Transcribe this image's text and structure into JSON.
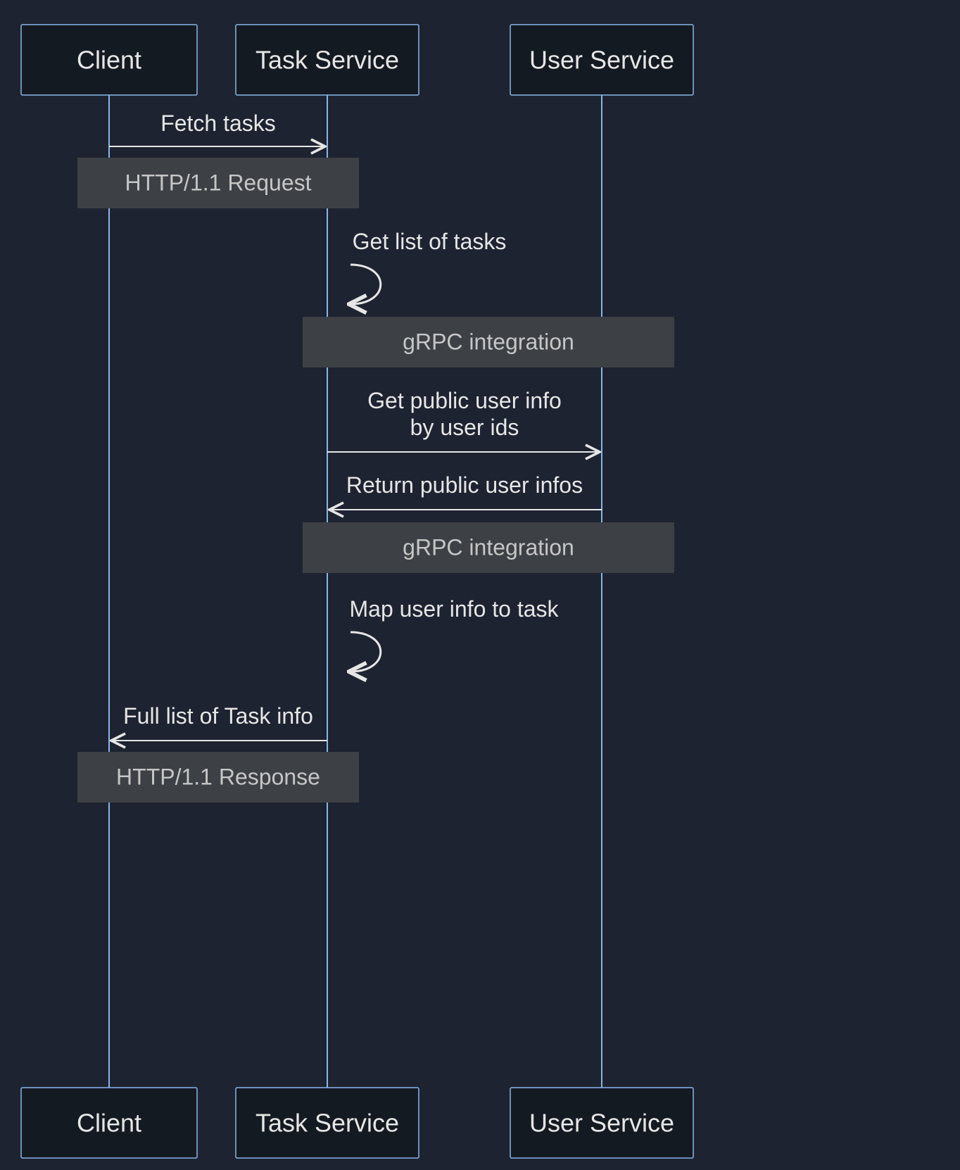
{
  "actors": {
    "client": "Client",
    "task_service": "Task Service",
    "user_service": "User Service"
  },
  "messages": {
    "fetch_tasks": "Fetch tasks",
    "get_list_tasks": "Get list of tasks",
    "get_public_user_info_l1": "Get public user info",
    "get_public_user_info_l2": "by user ids",
    "return_public_user_infos": "Return public user infos",
    "map_user_info": "Map user info to task",
    "full_list_task_info": "Full list of Task info"
  },
  "notes": {
    "http_request": "HTTP/1.1 Request",
    "grpc_integration_1": "gRPC integration",
    "grpc_integration_2": "gRPC integration",
    "http_response": "HTTP/1.1 Response"
  }
}
